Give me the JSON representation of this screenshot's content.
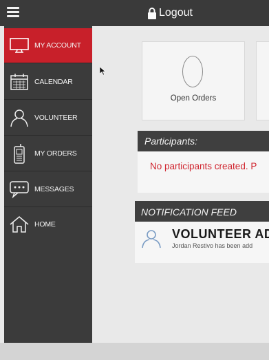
{
  "header": {
    "logout_label": "Logout",
    "menu_icon": "hamburger-icon",
    "lock_icon": "lock-icon"
  },
  "sidebar": {
    "items": [
      {
        "label": "MY ACCOUNT",
        "icon": "monitor-icon",
        "active": true
      },
      {
        "label": "CALENDAR",
        "icon": "calendar-icon",
        "active": false
      },
      {
        "label": "VOLUNTEER",
        "icon": "person-icon",
        "active": false
      },
      {
        "label": "MY ORDERS",
        "icon": "phone-icon",
        "active": false
      },
      {
        "label": "MESSAGES",
        "icon": "message-icon",
        "active": false
      },
      {
        "label": "HOME",
        "icon": "home-icon",
        "active": false
      }
    ]
  },
  "dashboard": {
    "open_orders": {
      "count": "0",
      "label": "Open Orders"
    }
  },
  "participants": {
    "heading": "Participants:",
    "message": "No participants created. P"
  },
  "notification_feed": {
    "heading": "NOTIFICATION FEED",
    "items": [
      {
        "title": "VOLUNTEER AD",
        "detail": "Jordan Restivo has been add",
        "icon": "user-icon"
      }
    ]
  },
  "colors": {
    "accent": "#c8202a",
    "sidebar": "#3b3b3b",
    "header": "#3a3a3a",
    "alert_text": "#d0252f"
  }
}
